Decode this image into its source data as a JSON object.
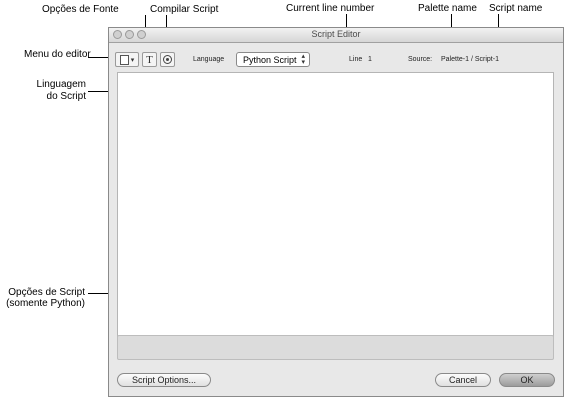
{
  "annotations": {
    "font_options": "Opções de Fonte",
    "compile_script": "Compilar Script",
    "current_line_number": "Current line number",
    "palette_name": "Palette name",
    "script_name": "Script name",
    "editor_menu": "Menu do editor",
    "script_language_line1": "Linguagem",
    "script_language_line2": "do Script",
    "script_options_line1": "Opções de Script",
    "script_options_line2": "(somente Python)"
  },
  "window": {
    "title": "Script Editor",
    "toolbar": {
      "menu_icon": "page-menu-icon",
      "font_icon": "T",
      "compile_icon": "compile-icon",
      "language_label": "Language",
      "language_value": "Python Script",
      "line_label": "Line",
      "line_value": "1",
      "source_label": "Source:",
      "source_value": "Palette-1 / Script-1"
    },
    "buttons": {
      "script_options": "Script Options...",
      "cancel": "Cancel",
      "ok": "OK"
    }
  }
}
